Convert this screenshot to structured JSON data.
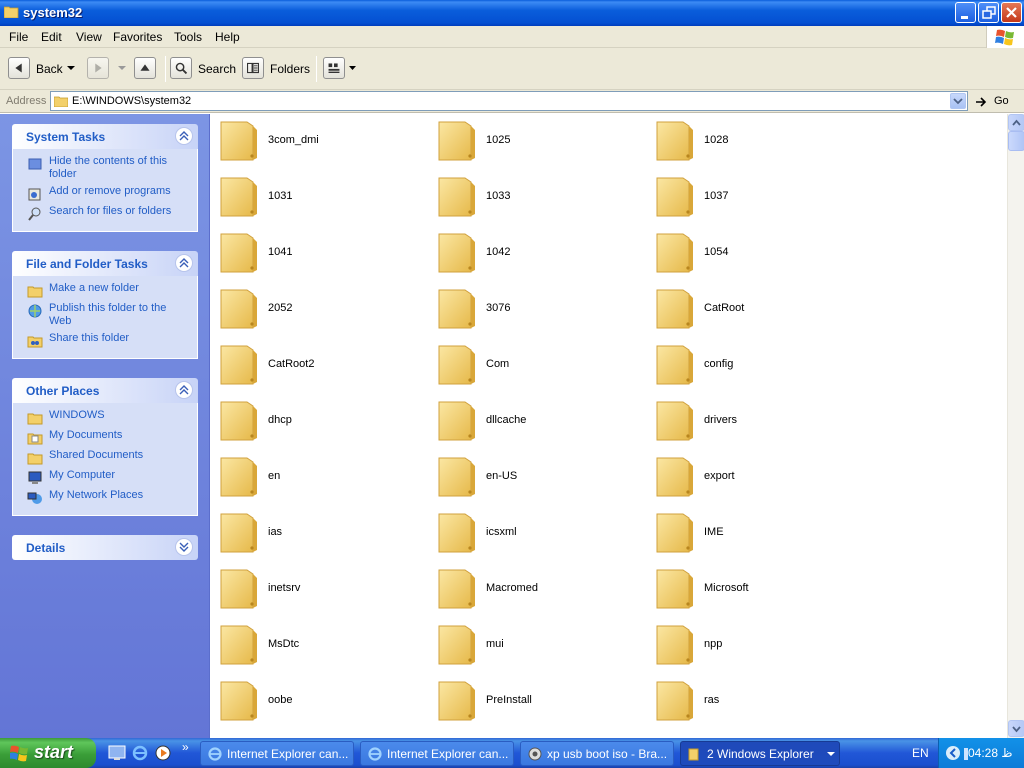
{
  "window": {
    "title": "system32",
    "buttons": [
      "minimize-icon",
      "restore-icon",
      "close-icon"
    ]
  },
  "menu": [
    "File",
    "Edit",
    "View",
    "Favorites",
    "Tools",
    "Help"
  ],
  "toolbar": {
    "back": "Back",
    "search": "Search",
    "folders": "Folders"
  },
  "address": {
    "label": "Address",
    "value": "E:\\WINDOWS\\system32",
    "go": "Go"
  },
  "left_panel": {
    "system_tasks": {
      "title": "System Tasks",
      "items": [
        "Hide the contents of this folder",
        "Add or remove programs",
        "Search for files or folders"
      ]
    },
    "file_folder_tasks": {
      "title": "File and Folder Tasks",
      "items": [
        "Make a new folder",
        "Publish this folder to the Web",
        "Share this folder"
      ]
    },
    "other_places": {
      "title": "Other Places",
      "items": [
        "WINDOWS",
        "My Documents",
        "Shared Documents",
        "My Computer",
        "My Network Places"
      ]
    },
    "details": {
      "title": "Details"
    }
  },
  "folders": [
    "3com_dmi",
    "1025",
    "1028",
    "1031",
    "1033",
    "1037",
    "1041",
    "1042",
    "1054",
    "2052",
    "3076",
    "CatRoot",
    "CatRoot2",
    "Com",
    "config",
    "dhcp",
    "dllcache",
    "drivers",
    "en",
    "en-US",
    "export",
    "ias",
    "icsxml",
    "IME",
    "inetsrv",
    "Macromed",
    "Microsoft",
    "MsDtc",
    "mui",
    "npp",
    "oobe",
    "PreInstall",
    "ras"
  ],
  "taskbar": {
    "start": "start",
    "tasks": [
      "Internet Explorer can...",
      "Internet Explorer can...",
      "xp usb boot iso - Bra...",
      "2 Windows Explorer"
    ],
    "language": "EN",
    "clock": "04:28 ظ"
  },
  "colors": {
    "titlebar": "#0a5ddb",
    "sidepanel": "#7c95e4",
    "panel_link": "#215dc6",
    "taskbar": "#2157d7",
    "start": "#3a9e38"
  }
}
